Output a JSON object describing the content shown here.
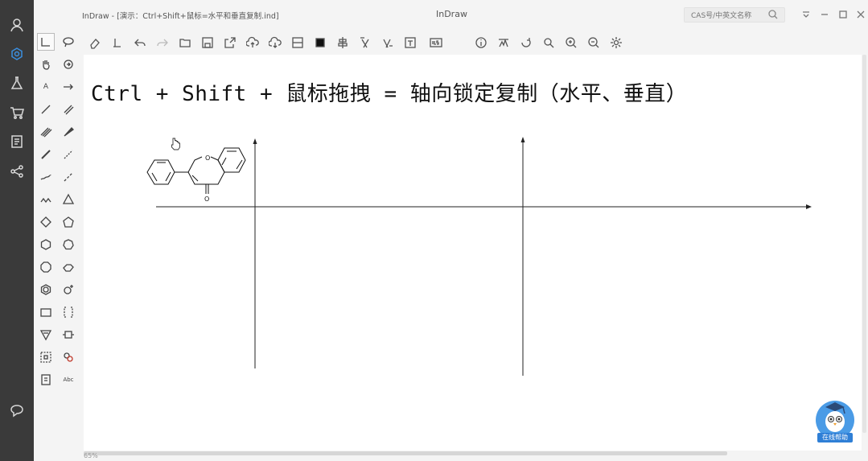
{
  "window": {
    "document_title": "InDraw - [演示：Ctrl+Shift+鼠标=水平和垂直复制.ind]",
    "app_name": "InDraw",
    "search_placeholder": "CAS号/中英文名称"
  },
  "canvas": {
    "headline": "Ctrl + Shift + 鼠标拖拽 = 轴向锁定复制（水平、垂直）",
    "molecule": {
      "atom_labels": [
        "O",
        "O"
      ]
    }
  },
  "status": {
    "zoom": "65%"
  },
  "assistant": {
    "label": "在线帮助"
  },
  "icons": {
    "rail": [
      "user-icon",
      "structure-icon",
      "flask-icon",
      "cart-icon",
      "notes-icon",
      "share-icon",
      "chat-icon"
    ],
    "toolbar": [
      "eraser-icon",
      "clear-icon",
      "undo-icon",
      "redo-icon",
      "open-icon",
      "save-icon",
      "export-icon",
      "cloud-upload-icon",
      "cloud-download-icon",
      "layout-icon",
      "color-icon",
      "align-icon",
      "name-to-structure-icon",
      "structure-to-name-icon",
      "text-icon",
      "ids-icon",
      "info-icon",
      "nmr-icon",
      "rotate-icon",
      "search-icon",
      "zoom-in-icon",
      "zoom-out-icon",
      "settings-icon"
    ]
  },
  "palette": {
    "text_tool_label": "A",
    "abbr_tool_label": "Abc"
  }
}
